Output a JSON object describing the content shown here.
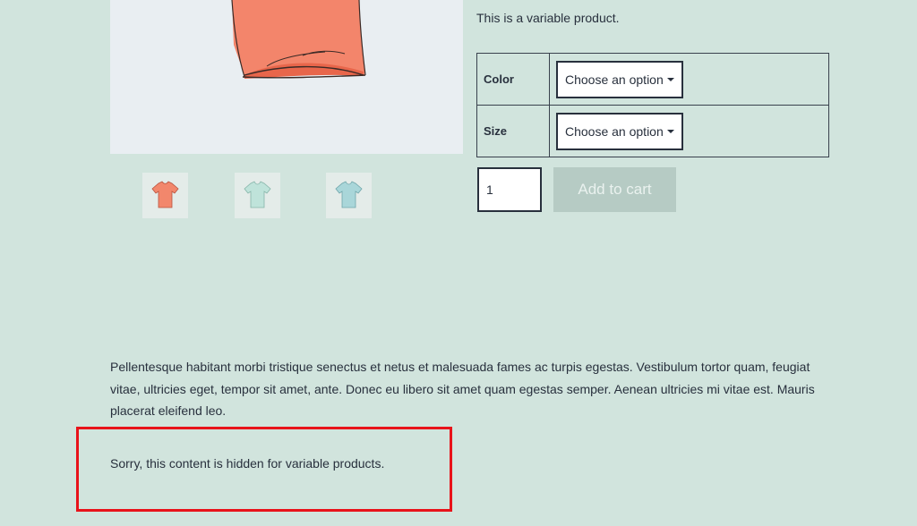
{
  "product": {
    "short_description": "This is a variable product.",
    "long_description": "Pellentesque habitant morbi tristique senectus et netus et malesuada fames ac turpis egestas. Vestibulum tortor quam, feugiat vitae, ultricies eget, tempor sit amet, ante. Donec eu libero sit amet quam egestas semper. Aenean ultricies mi vitae est. Mauris placerat eleifend leo.",
    "notice": "Sorry, this content is hidden for variable products."
  },
  "gallery": {
    "thumbnails": [
      {
        "icon": "tshirt-icon",
        "color": "#f2876c"
      },
      {
        "icon": "tshirt-icon",
        "color": "#bfe3da"
      },
      {
        "icon": "tshirt-icon",
        "color": "#a9d6d9"
      }
    ]
  },
  "variations": {
    "color": {
      "label": "Color",
      "selected": "Choose an option"
    },
    "size": {
      "label": "Size",
      "selected": "Choose an option"
    }
  },
  "cart": {
    "quantity": "1",
    "button_label": "Add to cart"
  },
  "colors": {
    "background": "#d1e4dd",
    "text": "#28303d",
    "button_disabled": "#b6cbc4",
    "highlight_border": "#e8131a"
  }
}
